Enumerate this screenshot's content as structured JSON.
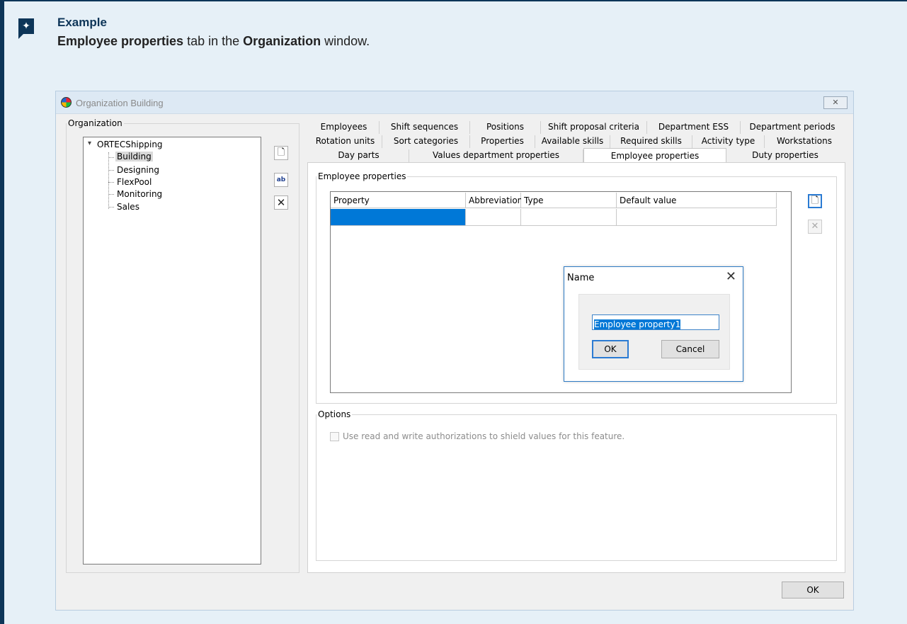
{
  "callout": {
    "icon": "sparkle-icon",
    "title": "Example",
    "text_bold_1": "Employee properties",
    "text_1": " tab in the ",
    "text_bold_2": "Organization",
    "text_2": " window."
  },
  "window": {
    "title": "Organization Building",
    "close_glyph": "✕",
    "ok_label": "OK"
  },
  "organization": {
    "legend": "Organization",
    "root": "ORTECShipping",
    "children": [
      "Building",
      "Designing",
      "FlexPool",
      "Monitoring",
      "Sales"
    ],
    "selected": "Building",
    "new_glyph": "🗋",
    "rename_glyph": "ab",
    "delete_glyph": "✕"
  },
  "tabs": {
    "row1": [
      "Employees",
      "Shift sequences",
      "Positions",
      "Shift proposal criteria",
      "Department ESS",
      "Department periods"
    ],
    "row2": [
      "Rotation units",
      "Sort categories",
      "Properties",
      "Available skills",
      "Required skills",
      "Activity type",
      "Workstations"
    ],
    "row3": [
      "Day parts",
      "Values department properties",
      "Employee properties",
      "Duty properties"
    ],
    "active": "Employee properties"
  },
  "employee_properties": {
    "legend": "Employee properties",
    "columns": [
      "Property",
      "Abbreviation",
      "Type",
      "Default value"
    ],
    "new_glyph": "🗋",
    "delete_glyph": "✕"
  },
  "name_dialog": {
    "title": "Name",
    "close_glyph": "✕",
    "value": "Employee property1",
    "ok_label": "OK",
    "cancel_label": "Cancel"
  },
  "options": {
    "legend": "Options",
    "checkbox_label": "Use read and write authorizations to shield values for this feature.",
    "checked": false
  },
  "colors": {
    "accent": "#0d3558",
    "callout_bg": "#e6f0f7",
    "selection": "#0078d7"
  }
}
